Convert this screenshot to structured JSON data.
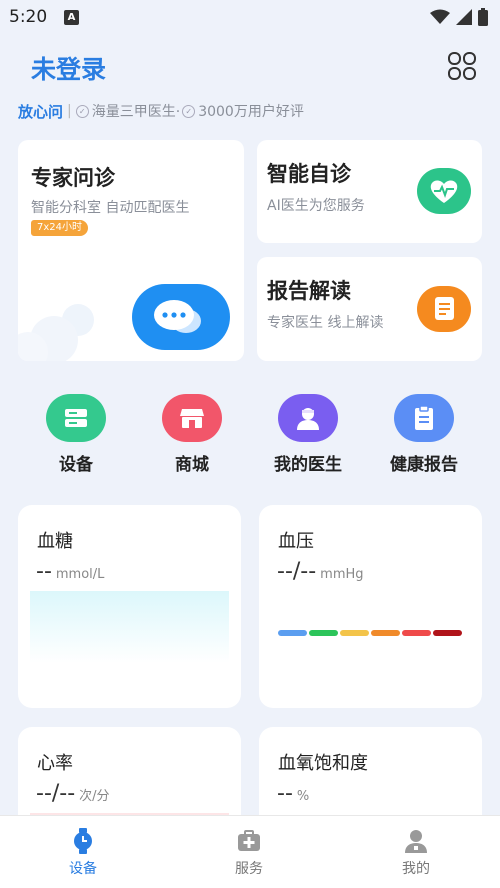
{
  "status": {
    "time": "5:20",
    "app_icon_letter": "A"
  },
  "header": {
    "title": "未登录",
    "grid_icon": "grid-icon"
  },
  "subrow": {
    "brand": "放心问",
    "sep": "|",
    "badge1": "海量三甲医生·",
    "badge2": "3000万用户好评"
  },
  "cards": {
    "consult": {
      "title": "专家问诊",
      "subtitle": "智能分科室 自动匹配医生",
      "tag": "7x24小时",
      "icon": "chat-bubbles-icon"
    },
    "self_check": {
      "title": "智能自诊",
      "subtitle": "AI医生为您服务",
      "icon": "heartbeat-icon"
    },
    "report": {
      "title": "报告解读",
      "subtitle": "专家医生 线上解读",
      "icon": "document-icon"
    }
  },
  "shortcuts": [
    {
      "label": "设备",
      "icon": "device-icon",
      "color": "#34c98e"
    },
    {
      "label": "商城",
      "icon": "store-icon",
      "color": "#f2566a"
    },
    {
      "label": "我的医生",
      "icon": "doctor-icon",
      "color": "#7a5ef0"
    },
    {
      "label": "健康报告",
      "icon": "clipboard-icon",
      "color": "#5b8ef5"
    }
  ],
  "metrics": {
    "glucose": {
      "title": "血糖",
      "value": "--",
      "unit": "mmol/L"
    },
    "pressure": {
      "title": "血压",
      "value": "--/--",
      "unit": "mmHg"
    },
    "heart": {
      "title": "心率",
      "value": "--/--",
      "unit": "次/分"
    },
    "oxygen": {
      "title": "血氧饱和度",
      "value": "--",
      "unit": "%"
    }
  },
  "bp_scale_colors": [
    "#5b9ef0",
    "#2cc45a",
    "#f3c44a",
    "#f08a2a",
    "#ef4a4a",
    "#b0141a"
  ],
  "tabs": [
    {
      "label": "设备",
      "icon": "watch-icon",
      "active": true
    },
    {
      "label": "服务",
      "icon": "medical-kit-icon",
      "active": false
    },
    {
      "label": "我的",
      "icon": "user-icon",
      "active": false
    }
  ],
  "colors": {
    "accent": "#2a7de1",
    "background": "#eef2fa"
  }
}
